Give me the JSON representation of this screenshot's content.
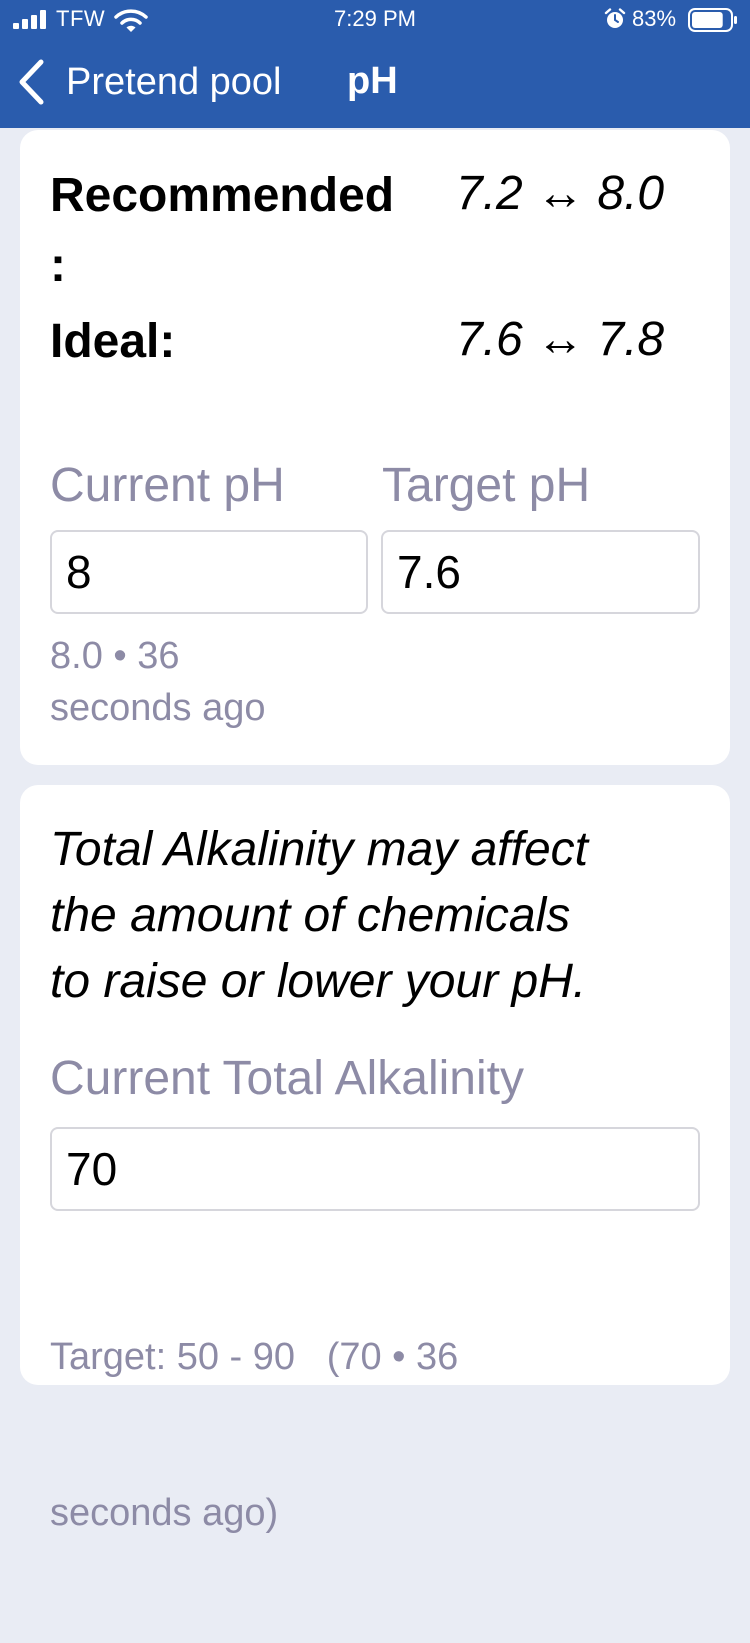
{
  "status_bar": {
    "carrier": "TFW",
    "time": "7:29 PM",
    "battery_percent": "83%",
    "battery_level": 0.83
  },
  "nav": {
    "back_label": "Pretend pool",
    "title": "pH"
  },
  "ranges": {
    "recommended_label": "Recommended",
    "recommended_colon": ":",
    "recommended_value": "7.2 ↔ 8.0",
    "ideal_label": "Ideal:",
    "ideal_value": "7.6 ↔ 7.8"
  },
  "readings": {
    "current_label": "Current pH",
    "current_value": "8",
    "target_label": "Target pH",
    "target_value": "7.6",
    "last_reading_line1": "8.0 • 36",
    "last_reading_line2": "seconds ago"
  },
  "alkalinity": {
    "note_line1": "Total Alkalinity may affect",
    "note_line2": "the amount of chemicals",
    "note_line3": "to raise or lower your pH.",
    "label": "Current Total Alkalinity",
    "value": "70",
    "hint_line1": "Target: 50 - 90   (70 • 36",
    "hint_line2": "seconds ago)"
  },
  "colors": {
    "nav_background": "#2a5cad",
    "page_background": "#e9ecf4",
    "label_gray": "#8d8ba6"
  }
}
